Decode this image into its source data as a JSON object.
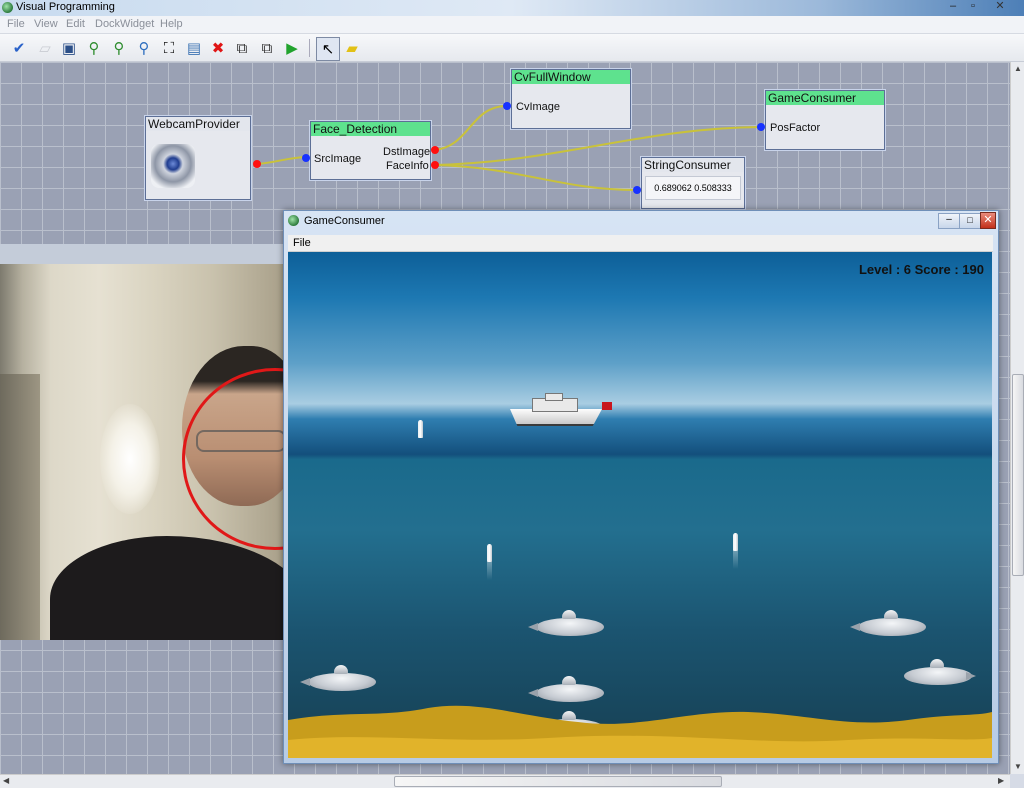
{
  "window": {
    "title": "Visual Programming"
  },
  "menubar": {
    "items": [
      "File",
      "View",
      "Edit",
      "DockWidget",
      "Help"
    ]
  },
  "toolbar": {
    "icons": [
      "pin-icon",
      "new-file-icon",
      "save-icon",
      "zoom-fit-icon",
      "zoom-in-icon",
      "zoom-out-icon",
      "fullscreen-icon",
      "camera-icon",
      "delete-icon",
      "copy-icon",
      "paste-icon",
      "run-icon",
      "pointer-icon",
      "note-icon"
    ]
  },
  "nodes": {
    "webcam": {
      "title": "WebcamProvider"
    },
    "face": {
      "title": "Face_Detection",
      "input": "SrcImage",
      "out1": "DstImage",
      "out2": "FaceInfo"
    },
    "cvwin": {
      "title": "CvFullWindow",
      "input": "CvImage"
    },
    "game": {
      "title": "GameConsumer",
      "input": "PosFactor"
    },
    "string": {
      "title": "StringConsumer",
      "value": "0.689062 0.508333"
    }
  },
  "game_window": {
    "title": "GameConsumer",
    "menu": "File",
    "hud": "Level : 6 Score : 190"
  },
  "colors": {
    "node_header": "#5ee28e",
    "port_in": "#1732ff",
    "port_out": "#ff1010",
    "wire": "#c9c23a"
  }
}
